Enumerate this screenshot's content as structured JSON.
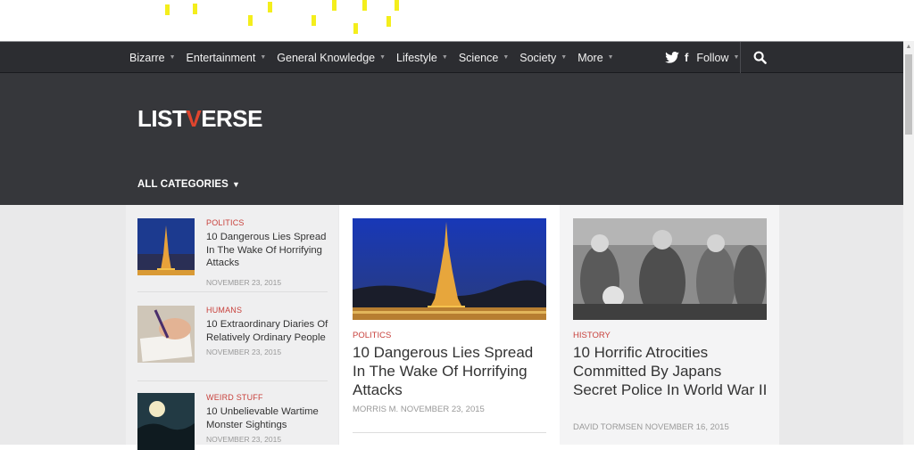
{
  "nav": {
    "items": [
      {
        "label": "Bizarre"
      },
      {
        "label": "Entertainment"
      },
      {
        "label": "General Knowledge"
      },
      {
        "label": "Lifestyle"
      },
      {
        "label": "Science"
      },
      {
        "label": "Society"
      },
      {
        "label": "More"
      }
    ],
    "follow_label": "Follow",
    "icons": [
      "twitter-icon",
      "facebook-icon",
      "search-icon"
    ]
  },
  "header": {
    "logo_part1": "LIST",
    "logo_v": "V",
    "logo_part2": "ERSE",
    "all_categories": "ALL CATEGORIES",
    "accent": "#e0452e"
  },
  "sidebar": {
    "items": [
      {
        "category": "POLITICS",
        "title": "10 Dangerous Lies Spread In The Wake Of Horrifying Attacks",
        "date": "NOVEMBER 23, 2015",
        "thumb": "eiffel-tower-night"
      },
      {
        "category": "HUMANS",
        "title": "10 Extraordinary Diaries Of Relatively Ordinary People",
        "date": "NOVEMBER 23, 2015",
        "thumb": "hand-writing-diary"
      },
      {
        "category": "WEIRD STUFF",
        "title": "10 Unbelievable Wartime Monster Sightings",
        "date": "NOVEMBER 23, 2015",
        "thumb": "moonlit-night"
      }
    ]
  },
  "cards": [
    {
      "category": "POLITICS",
      "title": "10 Dangerous Lies Spread In The Wake Of Horrifying Attacks",
      "meta": "MORRIS M. NOVEMBER 23, 2015",
      "image": "eiffel-tower-night"
    },
    {
      "category": "HISTORY",
      "title": "10 Horrific Atrocities Committed By Japans Secret Police In World War II",
      "meta": "DAVID TORMSEN NOVEMBER 16, 2015",
      "image": "military-police-photo"
    }
  ],
  "colors": {
    "category_red": "#c8413c",
    "navbar_bg": "#2c2d31",
    "header_bg": "#36373b"
  }
}
